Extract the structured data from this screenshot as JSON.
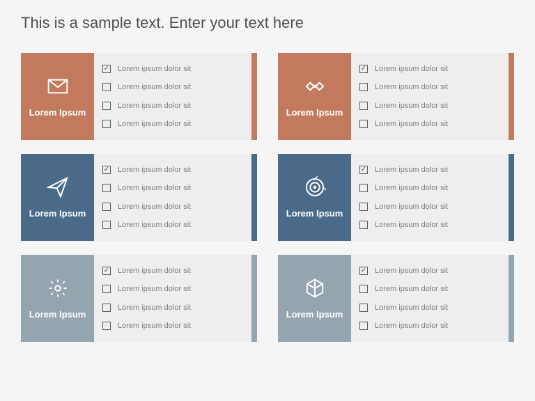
{
  "title": "This is a sample text. Enter your text here",
  "item_text": "Lorem ipsum dolor sit",
  "cards": [
    {
      "icon": "envelope-icon",
      "label": "Lorem Ipsum",
      "color": "c-orange",
      "checks": [
        true,
        false,
        false,
        false
      ]
    },
    {
      "icon": "handshake-icon",
      "label": "Lorem Ipsum",
      "color": "c-orange",
      "checks": [
        true,
        false,
        false,
        false
      ]
    },
    {
      "icon": "paper-plane-icon",
      "label": "Lorem Ipsum",
      "color": "c-blue",
      "checks": [
        true,
        false,
        false,
        false
      ]
    },
    {
      "icon": "target-icon",
      "label": "Lorem Ipsum",
      "color": "c-blue",
      "checks": [
        true,
        false,
        false,
        false
      ]
    },
    {
      "icon": "gear-icon",
      "label": "Lorem Ipsum",
      "color": "c-gray",
      "checks": [
        true,
        false,
        false,
        false
      ]
    },
    {
      "icon": "cube-icon",
      "label": "Lorem Ipsum",
      "color": "c-gray",
      "checks": [
        true,
        false,
        false,
        false
      ]
    }
  ]
}
